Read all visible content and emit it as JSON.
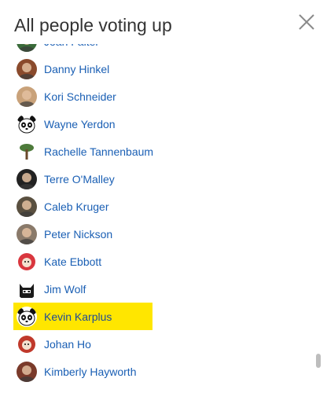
{
  "dialog": {
    "title": "All people voting up",
    "close_icon": "close-icon"
  },
  "voters": [
    {
      "name": "Joan Falter",
      "avatar": "avatar-photo-icon",
      "color": "#3a6b3a"
    },
    {
      "name": "Danny Hinkel",
      "avatar": "avatar-photo-icon",
      "color": "#8a4a2c"
    },
    {
      "name": "Kori Schneider",
      "avatar": "avatar-photo-icon",
      "color": "#c9a27a"
    },
    {
      "name": "Wayne Yerdon",
      "avatar": "panda-icon",
      "color": "#ffffff"
    },
    {
      "name": "Rachelle Tannenbaum",
      "avatar": "tree-icon",
      "color": "#4d7a3a"
    },
    {
      "name": "Terre O'Malley",
      "avatar": "avatar-photo-icon",
      "color": "#222222"
    },
    {
      "name": "Caleb Kruger",
      "avatar": "avatar-photo-icon",
      "color": "#5a5040"
    },
    {
      "name": "Peter Nickson",
      "avatar": "avatar-photo-icon",
      "color": "#8a7a6a"
    },
    {
      "name": "Kate Ebbott",
      "avatar": "cartoon-red-icon",
      "color": "#d9363e"
    },
    {
      "name": "Jim Wolf",
      "avatar": "batman-icon",
      "color": "#1a1a1a"
    },
    {
      "name": "Kevin Karplus",
      "avatar": "panda-icon",
      "color": "#ffffff",
      "highlighted": true
    },
    {
      "name": "Johan Ho",
      "avatar": "cartoon-red-icon",
      "color": "#c0392b"
    },
    {
      "name": "Kimberly Hayworth",
      "avatar": "avatar-photo-icon",
      "color": "#7a3a2a"
    }
  ],
  "colors": {
    "link": "#1a5fb4",
    "highlight": "#ffe600",
    "title": "#333333"
  }
}
